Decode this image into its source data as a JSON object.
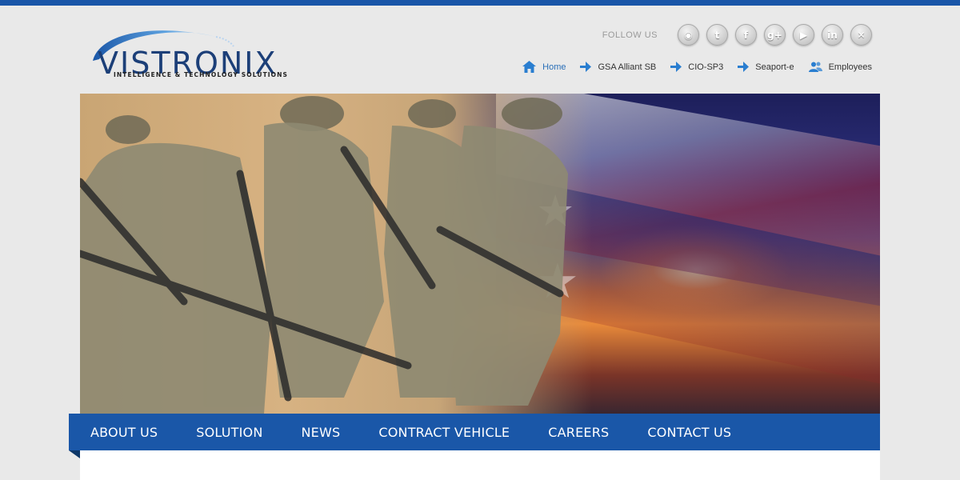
{
  "brand": {
    "name": "VISTRONIX",
    "tagline": "INTELLIGENCE & TECHNOLOGY SOLUTIONS",
    "colors": {
      "primary": "#1a57a8",
      "logo": "#1c3f78",
      "accent_link": "#2a6fb8"
    }
  },
  "follow": {
    "label": "FOLLOW US",
    "icons": [
      {
        "name": "rss-icon",
        "glyph": "◉"
      },
      {
        "name": "twitter-icon",
        "glyph": "t"
      },
      {
        "name": "facebook-icon",
        "glyph": "f"
      },
      {
        "name": "googleplus-icon",
        "glyph": "g+"
      },
      {
        "name": "youtube-icon",
        "glyph": "▶"
      },
      {
        "name": "linkedin-icon",
        "glyph": "in"
      },
      {
        "name": "xing-icon",
        "glyph": "✕"
      }
    ]
  },
  "quick_links": [
    {
      "label": "Home",
      "icon": "home-icon",
      "active": true
    },
    {
      "label": "GSA Alliant SB",
      "icon": "arrow-right-icon"
    },
    {
      "label": "CIO-SP3",
      "icon": "arrow-right-icon"
    },
    {
      "label": "Seaport-e",
      "icon": "arrow-right-icon"
    },
    {
      "label": "Employees",
      "icon": "users-icon"
    }
  ],
  "nav": {
    "items": [
      "ABOUT US",
      "SOLUTION",
      "NEWS",
      "CONTRACT VEHICLE",
      "CAREERS",
      "CONTACT US"
    ]
  },
  "banner": {
    "description_icon": "hero-banner-image"
  }
}
